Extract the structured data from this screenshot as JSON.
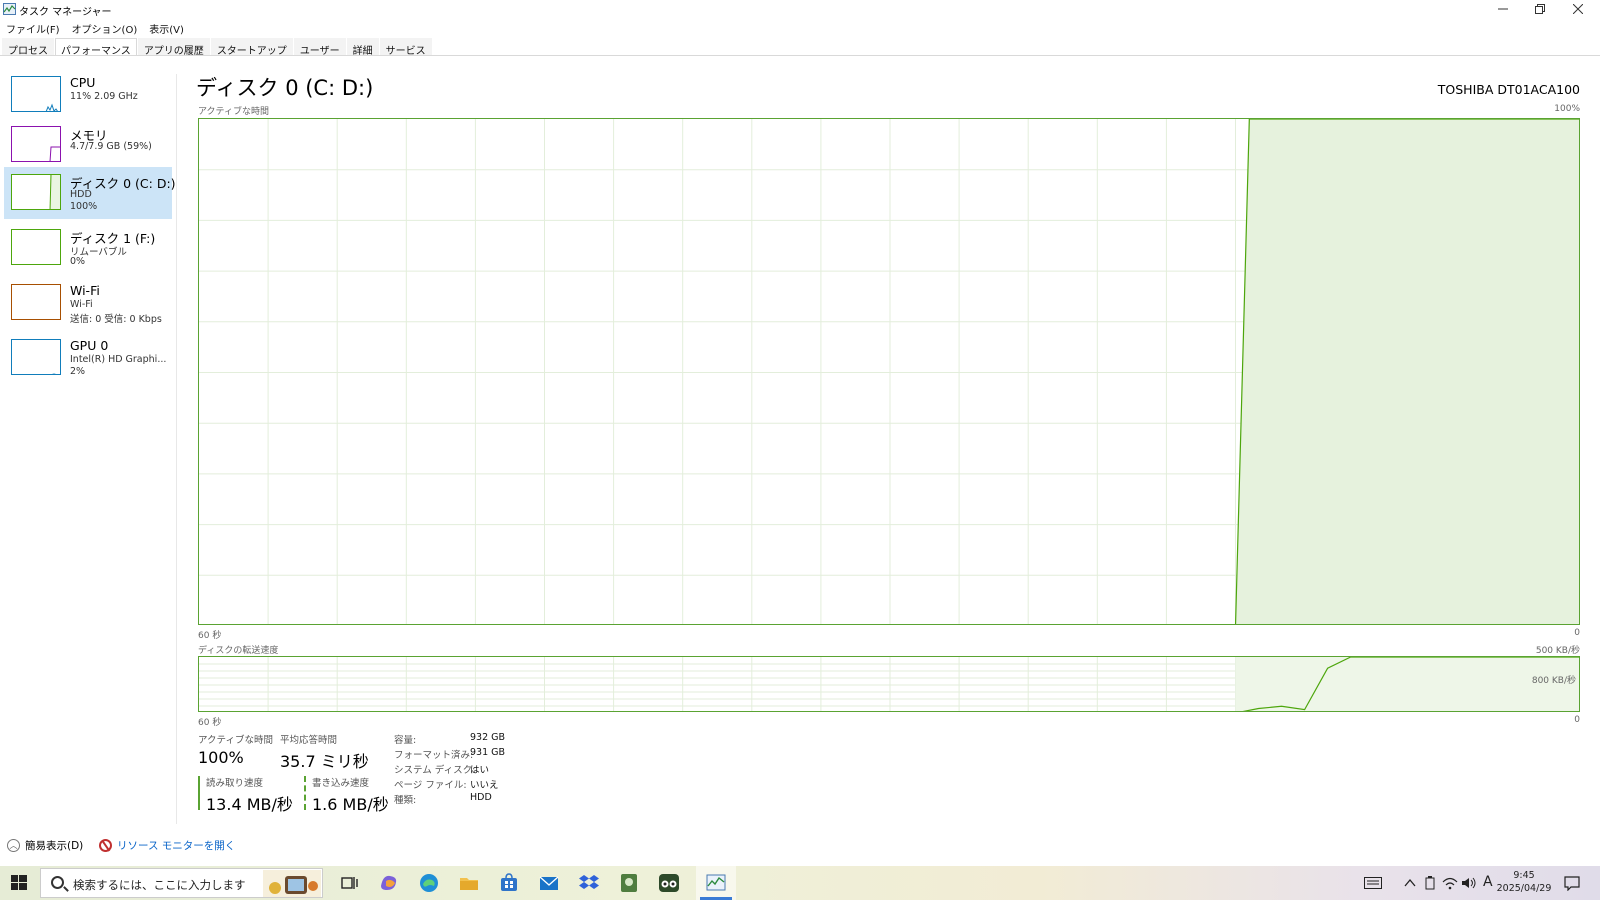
{
  "window": {
    "title": "タスク マネージャー",
    "minimize_icon": "minimize-icon",
    "maximize_icon": "restore-icon",
    "close_icon": "close-icon"
  },
  "menu": [
    "ファイル(F)",
    "オプション(O)",
    "表示(V)"
  ],
  "tabs": [
    {
      "label": "プロセス",
      "active": false
    },
    {
      "label": "パフォーマンス",
      "active": true
    },
    {
      "label": "アプリの履歴",
      "active": false
    },
    {
      "label": "スタートアップ",
      "active": false
    },
    {
      "label": "ユーザー",
      "active": false
    },
    {
      "label": "詳細",
      "active": false
    },
    {
      "label": "サービス",
      "active": false
    }
  ],
  "sidebar": {
    "items": [
      {
        "name": "CPU",
        "line2": "11%  2.09 GHz",
        "line3": "",
        "color": "#117dbb",
        "selected": false
      },
      {
        "name": "メモリ",
        "line2": "4.7/7.9 GB (59%)",
        "line3": "",
        "color": "#8b12ae",
        "selected": false
      },
      {
        "name": "ディスク 0 (C: D:)",
        "line2": "HDD",
        "line3": "100%",
        "color": "#4da60c",
        "selected": true
      },
      {
        "name": "ディスク 1 (F:)",
        "line2": "リムーバブル",
        "line3": "0%",
        "color": "#4da60c",
        "selected": false
      },
      {
        "name": "Wi-Fi",
        "line2": "Wi-Fi",
        "line3": "送信: 0 受信: 0 Kbps",
        "color": "#a74f01",
        "selected": false
      },
      {
        "name": "GPU 0",
        "line2": "Intel(R) HD Graphi...",
        "line3": "2%",
        "color": "#117dbb",
        "selected": false
      }
    ]
  },
  "main": {
    "title": "ディスク 0 (C: D:)",
    "model": "TOSHIBA DT01ACA100",
    "active_chart": {
      "label": "アクティブな時間",
      "max_label": "100%",
      "x_left_label": "60 秒",
      "x_right_label": "0"
    },
    "transfer_chart": {
      "label": "ディスクの転送速度",
      "max_label": "500 KB/秒",
      "mid_label": "800 KB/秒",
      "x_left_label": "60 秒",
      "x_right_label": "0"
    }
  },
  "chart_data": [
    {
      "type": "area",
      "title": "アクティブな時間",
      "x": [
        60,
        15,
        14.4,
        0
      ],
      "values": [
        0,
        0,
        100,
        100
      ],
      "ylim": [
        0,
        100
      ],
      "xlim": [
        60,
        0
      ],
      "grid": true
    },
    {
      "type": "line",
      "title": "ディスクの転送速度",
      "x": [
        60,
        15,
        14,
        13,
        12,
        11,
        10,
        0
      ],
      "values": [
        0,
        0,
        40,
        60,
        30,
        400,
        500,
        500
      ],
      "ylim": [
        0,
        500
      ],
      "xlim": [
        60,
        0
      ],
      "grid": true
    }
  ],
  "stats": {
    "active_time_label": "アクティブな時間",
    "active_time_value": "100%",
    "avg_response_label": "平均応答時間",
    "avg_response_value": "35.7 ミリ秒",
    "read_speed_label": "読み取り速度",
    "read_speed_value": "13.4 MB/秒",
    "write_speed_label": "書き込み速度",
    "write_speed_value": "1.6 MB/秒"
  },
  "properties": [
    {
      "label": "容量:",
      "value": "932 GB"
    },
    {
      "label": "フォーマット済み:",
      "value": "931 GB"
    },
    {
      "label": "システム ディスク:",
      "value": "はい"
    },
    {
      "label": "ページ ファイル:",
      "value": "いいえ"
    },
    {
      "label": "種類:",
      "value": "HDD"
    }
  ],
  "footer": {
    "fewer_details": "簡易表示(D)",
    "resource_monitor": "リソース モニターを開く"
  },
  "taskbar": {
    "search_placeholder": "検索するには、ここに入力します",
    "icons": [
      "task-view-icon",
      "copilot-icon",
      "edge-icon",
      "file-explorer-icon",
      "store-icon",
      "mail-icon",
      "dropbox-icon",
      "app-icon",
      "tripadvisor-icon",
      "task-manager-icon"
    ],
    "ime": "A",
    "time": "9:45",
    "date": "2025/04/29"
  }
}
